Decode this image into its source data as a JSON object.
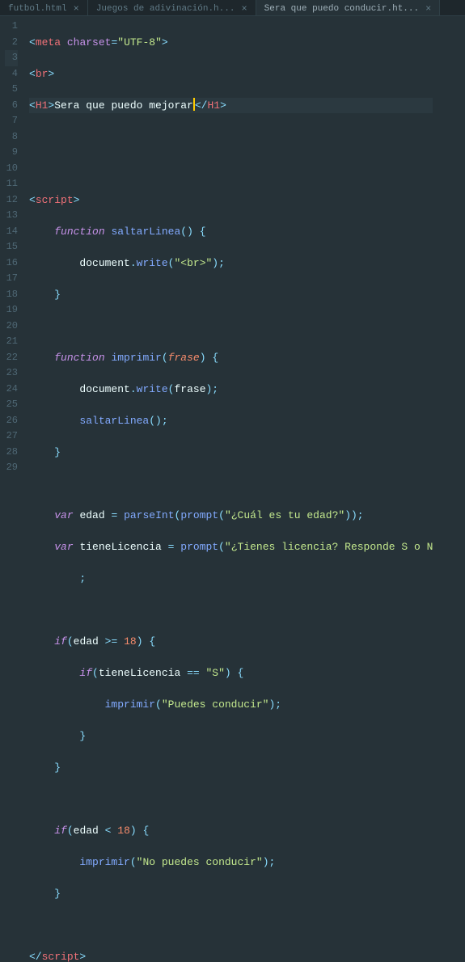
{
  "tabs": [
    {
      "label": "futbol.html",
      "active": false,
      "close": "×"
    },
    {
      "label": "Juegos de adivinación.h...",
      "active": false,
      "close": "×"
    },
    {
      "label": "Sera que puedo conducir.ht...",
      "active": true,
      "close": "×"
    }
  ],
  "lineNumbers": [
    "1",
    "2",
    "3",
    "4",
    "5",
    "6",
    "7",
    "8",
    "9",
    "10",
    "11",
    "12",
    "13",
    "14",
    "15",
    "16",
    "17",
    "",
    "18",
    "19",
    "20",
    "21",
    "22",
    "23",
    "24",
    "25",
    "26",
    "27",
    "28",
    "29"
  ],
  "code": {
    "meta_tag": "meta",
    "charset_attr": "charset",
    "charset_val": "\"UTF-8\"",
    "br_tag": "br",
    "h1_tag": "H1",
    "h1_text": "Sera que puedo mejorar",
    "script_tag": "script",
    "kw_function": "function",
    "fn_saltarLinea": "saltarLinea",
    "fn_imprimir": "imprimir",
    "obj_document": "document",
    "m_write": "write",
    "str_br": "\"<br>\"",
    "param_frase": "frase",
    "kw_var": "var",
    "v_edad": "edad",
    "v_tieneLicencia": "tieneLicencia",
    "fn_parseInt": "parseInt",
    "fn_prompt": "prompt",
    "str_edad": "\"¿Cuál es tu edad?\"",
    "str_licencia": "\"¿Tienes licencia? Responde S o N",
    "kw_if": "if",
    "num_18": "18",
    "op_gte": ">=",
    "op_eq": "==",
    "op_lt": "<",
    "str_S": "\"S\"",
    "str_puedes": "\"Puedes conducir\"",
    "str_nopuedes": "\"No puedes conducir\""
  }
}
